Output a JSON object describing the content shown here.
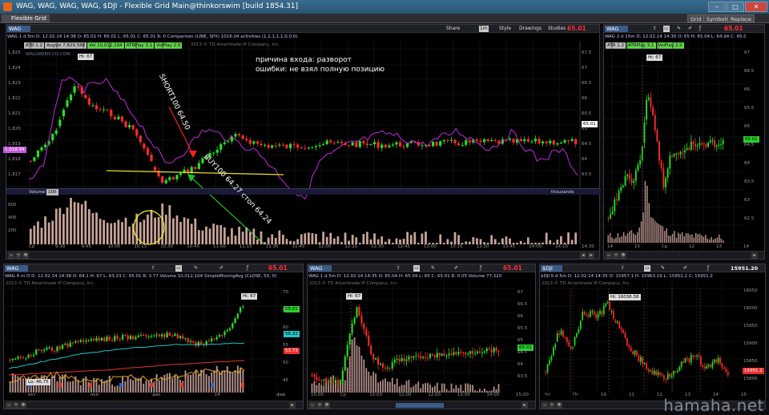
{
  "window": {
    "title": "WAG, WAG, WAG, WAG, $DJI - Flexible Grid Main@thinkorswim [build 1854.31]",
    "min": "–",
    "max": "□",
    "close": "✕"
  },
  "menubar": {
    "tab": "Flexible Grid",
    "buttons": [
      "Grid",
      "Symbols",
      "Replace"
    ]
  },
  "main": {
    "symbol": "WAG",
    "price": "65.01",
    "header_buttons": {
      "share": "Share",
      "timeframe": "1m",
      "style": "Style",
      "drawings": "Drawings",
      "studies": "Studies"
    },
    "ohlc": "WAG 1 d 5m   D: 12.02.14 14:38   O: 65.01   H: 65.01   L: 65.01   C: 65.01   R: 0   Comparison (LINE, SPX)   1016.04   activities (1,1,1,1,1,0,0,0)",
    "studies": [
      "ATR 1.2",
      "AvgVol 7,829,588",
      "Vol 10,012,104",
      "ATRPlay 3.1",
      "VolPlay 2.0"
    ],
    "copyright": "2013 © TD Ameritrade IP Company, Inc.",
    "watermark": "WALGREEN.CO.COM",
    "hi_label": "Hi: 67",
    "left_tag": "1,018.94",
    "right_tag": "65.01",
    "left_axis": [
      "1,825",
      "1,824",
      "1,823",
      "1,822",
      "1,821",
      "1,820",
      "1,819",
      "1,818",
      "1,817"
    ],
    "right_axis": [
      "67.5",
      "67",
      "66.5",
      "66",
      "65.5",
      "65",
      "64.5",
      "64",
      "63.5"
    ],
    "volume_label": "Volume",
    "volume_value": "100",
    "volume_units": "thousands",
    "volume_axis": [
      "600",
      "400",
      "200"
    ],
    "time_axis": [
      "Ср",
      "9:30",
      "9:45",
      "10:00",
      "10:15",
      "10:30",
      "10:45",
      "11:00",
      "11:15",
      "11:30",
      "11:45",
      "12:00",
      "12:15",
      "12:30",
      "12:45",
      "13:00",
      "13:15",
      "13:30",
      "13:45",
      "14:00",
      "14:15",
      "14:30"
    ],
    "annotations": {
      "reason": "причина входа: разворот",
      "mistakes": "ошибки: не взял полную позицию",
      "short": "SHORT100 64.50",
      "buy": "BUY100 64.27 стоп 64.24"
    }
  },
  "topright": {
    "symbol": "WAG",
    "price": "65.01",
    "ohlc": "WAG 2 d 15m  D: 12.02.14 14:30  O: 65  H: 65.04  L: 64.94  C: 65.01",
    "studies": [
      "ATR 1.2",
      "ATRPlay 3.1",
      "VolPlay 2.0"
    ],
    "hi_label": "Hi: 67",
    "right_tag": "65.01",
    "right_axis": [
      "67",
      "66.5",
      "66",
      "65.5",
      "65",
      "64.5",
      "64",
      "63.5",
      "63",
      "62.5"
    ],
    "time_axis": [
      "14",
      "15",
      "Ср",
      "12",
      "13",
      "14"
    ]
  },
  "bottomleft": {
    "symbol": "WAG",
    "price": "65.01",
    "ohlc": "WAG 6 m D  D: 12.02.14 14:38  O: 64.1  H: 67  L: 63.23  C: 65.01  R: 3.77   Volume 10,012,104   SimpleMovingAvg (CLOSE, 50, 0)",
    "copyright": "2013 © TD Ameritrade IP Company, Inc.",
    "hi_label": "Hi: 67",
    "lo_label": "Lo: 46.75",
    "tags": [
      "65.01",
      "56.32",
      "53.73"
    ],
    "right_axis": [
      "70",
      "65",
      "60",
      "55",
      "50",
      "45"
    ],
    "time_axis": [
      "окт",
      "ноя",
      "дек",
      "14",
      "фев"
    ]
  },
  "bottommid": {
    "symbol": "WAG",
    "price": "65.01",
    "ohlc": "WAG 1 d 5m  D: 12.02.14 14:35  O: 65.04  H: 65.04  L: 65  C: 65.01  R: 0.05  Volume 77,320",
    "copyright": "2013 © TD Ameritrade IP Company, Inc.",
    "hi_label": "Hi: 67",
    "right_tag": "65.01",
    "right_axis": [
      "67",
      "66.5",
      "66",
      "65.5",
      "65",
      "64.5",
      "64",
      "63.5"
    ],
    "time_axis": [
      "15:00",
      "Ср",
      "10:00",
      "11:00",
      "12:00",
      "13:00",
      "14:00",
      "15:00"
    ]
  },
  "bottomright": {
    "symbol": "$DJI",
    "price": "15951.20",
    "ohlc": "$DJI 5 d 5m  D: 12.02.14 14:35  O: 15957.1  H: 15963.19  L: 15951.2  C: 15951.2",
    "copyright": "2013 © TD Ameritrade IP Company, Inc.",
    "hi_label": "Hi: 16036.58",
    "right_tag": "15951.2",
    "right_axis": [
      "16050",
      "16000",
      "15950",
      "15900",
      "15850",
      "15800"
    ],
    "time_axis": [
      "Чт",
      "Пт",
      "10",
      "11",
      "12",
      "13",
      "14",
      "15"
    ]
  }
}
